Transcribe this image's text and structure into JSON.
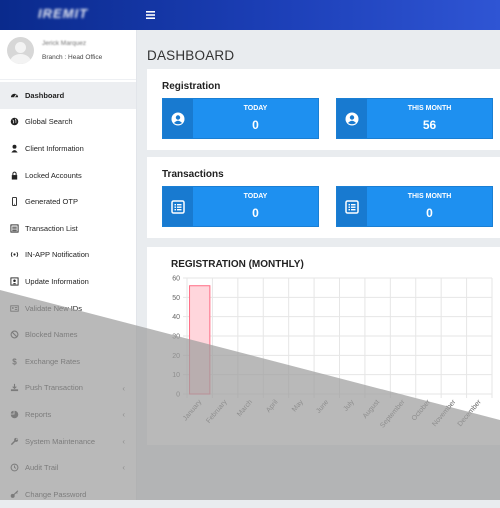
{
  "topbar": {
    "logo_text": "IREMIT",
    "menu_icon": "hamburger-icon"
  },
  "user": {
    "name": "Jerick Marquez",
    "branch": "Branch : Head Office"
  },
  "sidebar": {
    "items": [
      {
        "label": "Dashboard",
        "icon": "dashboard-icon",
        "active": true,
        "has_submenu": false
      },
      {
        "label": "Global Search",
        "icon": "globe-icon",
        "active": false,
        "has_submenu": false
      },
      {
        "label": "Client Information",
        "icon": "user-icon",
        "active": false,
        "has_submenu": false
      },
      {
        "label": "Locked Accounts",
        "icon": "lock-icon",
        "active": false,
        "has_submenu": false
      },
      {
        "label": "Generated OTP",
        "icon": "mobile-icon",
        "active": false,
        "has_submenu": false
      },
      {
        "label": "Transaction List",
        "icon": "list-icon",
        "active": false,
        "has_submenu": false
      },
      {
        "label": "IN-APP Notification",
        "icon": "broadcast-icon",
        "active": false,
        "has_submenu": false
      },
      {
        "label": "Update Information",
        "icon": "id-card-icon",
        "active": false,
        "has_submenu": false
      },
      {
        "label": "Validate New IDs",
        "icon": "id-badge-icon",
        "active": false,
        "has_submenu": false
      },
      {
        "label": "Blocked Names",
        "icon": "ban-icon",
        "active": false,
        "has_submenu": false
      },
      {
        "label": "Exchange Rates",
        "icon": "dollar-icon",
        "active": false,
        "has_submenu": false
      },
      {
        "label": "Push Transaction",
        "icon": "download-icon",
        "active": false,
        "has_submenu": true
      },
      {
        "label": "Reports",
        "icon": "pie-chart-icon",
        "active": false,
        "has_submenu": true
      },
      {
        "label": "System Maintenance",
        "icon": "wrench-icon",
        "active": false,
        "has_submenu": true
      },
      {
        "label": "Audit Trail",
        "icon": "history-icon",
        "active": false,
        "has_submenu": true
      },
      {
        "label": "Change Password",
        "icon": "key-icon",
        "active": false,
        "has_submenu": false
      }
    ],
    "submenu_chevron": "‹"
  },
  "main": {
    "title": "DASHBOARD",
    "registration": {
      "title": "Registration",
      "today_label": "TODAY",
      "today_value": "0",
      "month_label": "THIS MONTH",
      "month_value": "56"
    },
    "transactions": {
      "title": "Transactions",
      "today_label": "TODAY",
      "today_value": "0",
      "month_label": "THIS MONTH",
      "month_value": "0"
    }
  },
  "colors": {
    "accent": "#1e90f0",
    "accent_dark": "#187ad0",
    "topbar": "#1c3fb7",
    "bar_fill": "#ffd6dc",
    "bar_stroke": "#ff6b84",
    "overlay": "#9e9e9e"
  },
  "chart_data": {
    "type": "bar",
    "title": "REGISTRATION (MONTHLY)",
    "categories": [
      "January",
      "February",
      "March",
      "April",
      "May",
      "June",
      "July",
      "August",
      "September",
      "October",
      "November",
      "December"
    ],
    "values": [
      56,
      0,
      0,
      0,
      0,
      0,
      0,
      0,
      0,
      0,
      0,
      0
    ],
    "ylim": [
      0,
      60
    ],
    "yticks": [
      0,
      10,
      20,
      30,
      40,
      50,
      60
    ],
    "grid": true
  }
}
